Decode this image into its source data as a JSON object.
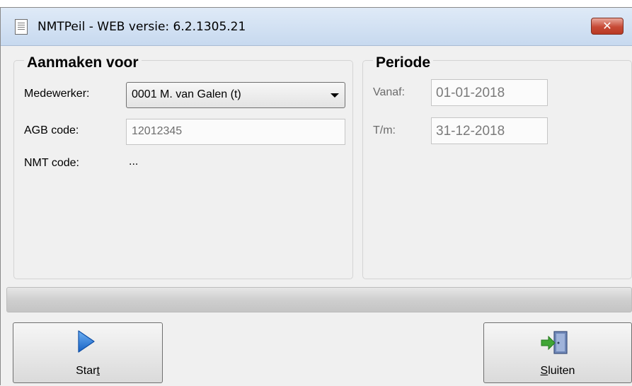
{
  "window": {
    "title": "NMTPeil - WEB versie: 6.2.1305.21",
    "close_glyph": "✕"
  },
  "aanmaken": {
    "title": "Aanmaken voor",
    "medewerker_label": "Medewerker:",
    "medewerker_value": "0001 M. van Galen (t)",
    "agb_label": "AGB code:",
    "agb_value": "12012345",
    "nmt_label": "NMT code:",
    "nmt_value": "..."
  },
  "periode": {
    "title": "Periode",
    "vanaf_label": "Vanaf:",
    "vanaf_value": "01-01-2018",
    "tm_label": "T/m:",
    "tm_value": "31-12-2018"
  },
  "progress": {
    "value": 0
  },
  "buttons": {
    "start_prefix": "Star",
    "start_mnemonic": "t",
    "sluiten_mnemonic": "S",
    "sluiten_rest": "luiten"
  },
  "icons": {
    "app": "document-icon",
    "start": "play-icon",
    "sluiten": "exit-door-icon"
  },
  "colors": {
    "titlebar": "#c7d9ef",
    "close": "#c74a36",
    "play": "#1f6fd1",
    "exit_arrow": "#3fa535"
  }
}
